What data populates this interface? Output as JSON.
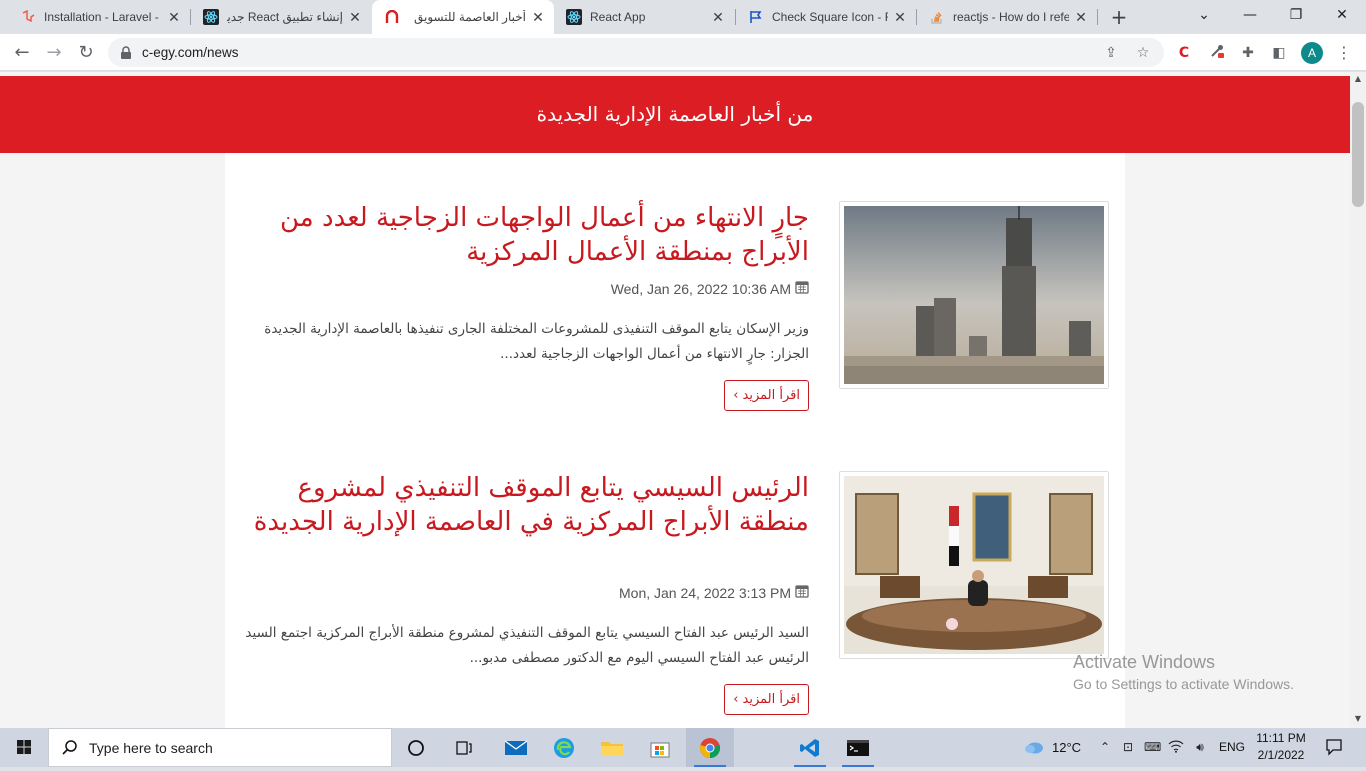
{
  "browser": {
    "tabs": [
      {
        "title": "Installation - Laravel -",
        "favicon": "laravel-icon",
        "active": false
      },
      {
        "title": "إنشاء تطبيق React جديد",
        "favicon": "react-icon",
        "active": false
      },
      {
        "title": "أخبار العاصمة للتسويق",
        "favicon": "c-egy-icon",
        "active": true
      },
      {
        "title": "React App",
        "favicon": "react-icon",
        "active": false
      },
      {
        "title": "Check Square Icon - R",
        "favicon": "flag-icon",
        "active": false
      },
      {
        "title": "reactjs - How do I refe",
        "favicon": "stackoverflow-icon",
        "active": false
      }
    ],
    "url": "c-egy.com/news",
    "profile_initial": "A"
  },
  "page": {
    "hero_title": "من أخبار العاصمة الإدارية الجديدة",
    "articles": [
      {
        "title": "جارٍ الانتهاء من أعمال الواجهات الزجاجية لعدد من الأبراج بمنطقة الأعمال المركزية",
        "date": "Wed, Jan 26, 2022 10:36 AM",
        "excerpt": "وزير الإسكان يتابع الموقف التنفيذى للمشروعات المختلفة الجارى تنفيذها بالعاصمة الإدارية الجديدة الجزار: جارٍ الانتهاء من أعمال الواجهات الزجاجية لعدد...",
        "read_more": "اقرأ المزيد ›"
      },
      {
        "title": "الرئيس السيسي يتابع الموقف التنفيذي لمشروع منطقة الأبراج المركزية في العاصمة الإدارية الجديدة",
        "date": "Mon, Jan 24, 2022 3:13 PM",
        "excerpt": "السيد الرئيس عبد الفتاح السيسي يتابع الموقف التنفيذي لمشروع منطقة الأبراج المركزية اجتمع السيد الرئيس عبد الفتاح السيسي اليوم مع الدكتور مصطفى مدبو...",
        "read_more": "اقرأ المزيد ›"
      }
    ]
  },
  "watermark": {
    "line1": "Activate Windows",
    "line2": "Go to Settings to activate Windows."
  },
  "taskbar": {
    "search_placeholder": "Type here to search",
    "weather": "12°C",
    "language": "ENG",
    "time": "11:11 PM",
    "date": "2/1/2022"
  },
  "colors": {
    "brand_red": "#dc1e24",
    "title_red": "#c8191f"
  }
}
